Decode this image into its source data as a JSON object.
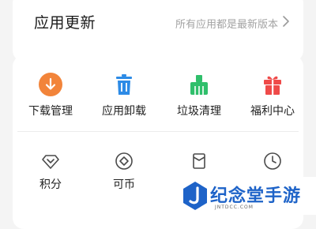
{
  "update": {
    "title": "应用更新",
    "status": "所有应用都是最新版本"
  },
  "tools": [
    {
      "label": "下载管理",
      "icon": "download-icon",
      "color": "#f2843a"
    },
    {
      "label": "应用卸载",
      "icon": "trash-icon",
      "color": "#2d8be6"
    },
    {
      "label": "垃圾清理",
      "icon": "broom-icon",
      "color": "#2fbf6b"
    },
    {
      "label": "福利中心",
      "icon": "gift-icon",
      "color": "#ef4a49"
    }
  ],
  "services": [
    {
      "label": "积分",
      "icon": "diamond-icon"
    },
    {
      "label": "可币",
      "icon": "coin-icon"
    }
  ],
  "watermark": {
    "text": "纪念堂手游",
    "url": "JNTDCC.COM"
  }
}
